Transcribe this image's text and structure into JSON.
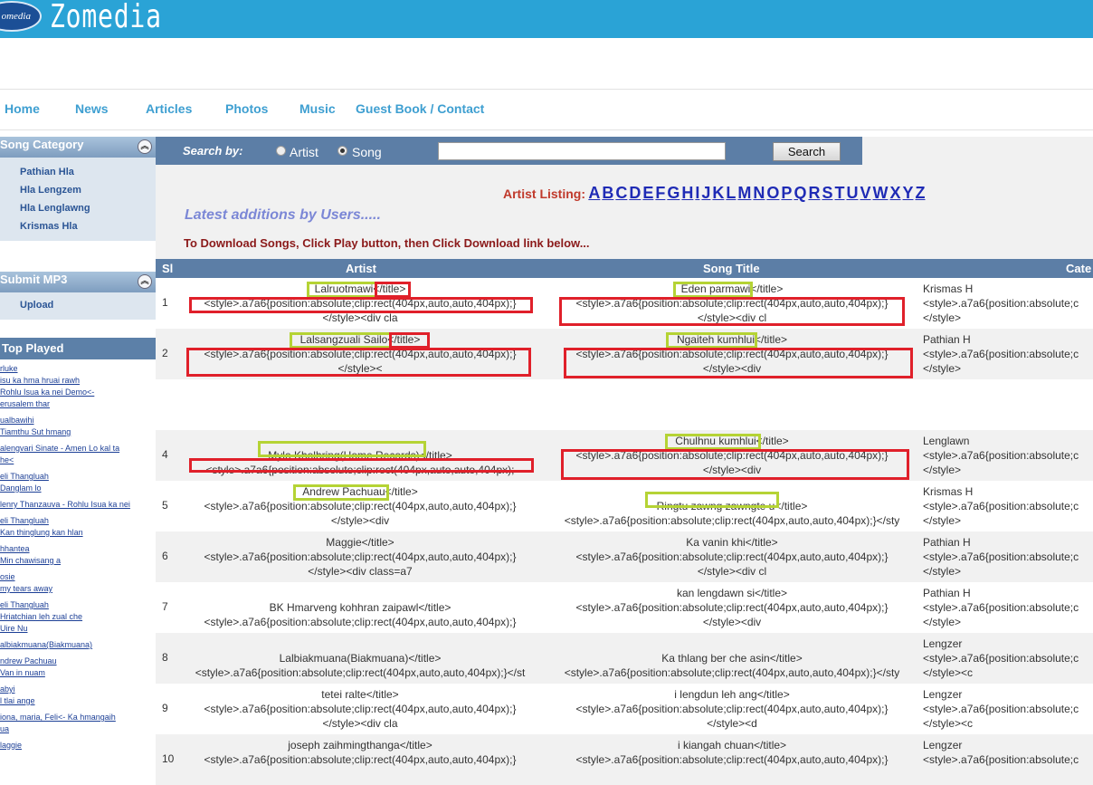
{
  "header": {
    "logo_badge": "omedia",
    "site_name": "Zomedia",
    "colors": {
      "bar": "#2aa3d6"
    }
  },
  "nav": [
    "Home",
    "News",
    "Articles",
    "Photos",
    "Music",
    "Guest Book / Contact"
  ],
  "sidebar": {
    "song_category": {
      "title": "Song Category",
      "items": [
        "Pathian Hla",
        "Hla Lengzem",
        "Hla Lenglawng",
        "Krismas Hla"
      ]
    },
    "submit": {
      "title": "Submit MP3",
      "items": [
        "Upload"
      ]
    },
    "top_played": {
      "title": "Top Played",
      "groups": [
        [
          "rluke",
          "isu ka hma hruai rawh",
          "Rohlu Isua ka nei Demo<-",
          "erusalem thar"
        ],
        [
          "ualbawihi",
          "Tiamthu Sut hmang"
        ],
        [
          "alengvari Sinate - Amen Lo kal ta",
          "he<"
        ],
        [
          "eli Thangluah",
          "Danglam lo"
        ],
        [
          "lenry Thanzauva - Rohlu Isua ka nei"
        ],
        [
          "eli Thangluah",
          "Kan thinglung kan hlan"
        ],
        [
          "hhantea",
          "Min chawisang a"
        ],
        [
          "osie",
          "my tears away"
        ],
        [
          "eli Thangluah",
          "Hriatchian leh zual che",
          "Uire Nu"
        ],
        [
          "albiakmuana(Biakmuana)"
        ],
        [
          "ndrew Pachuau",
          "Van in nuam"
        ],
        [
          "abyi",
          "l tlai ange"
        ],
        [
          "iona, maria, Feli<- Ka hmangaih",
          "ua"
        ],
        [
          "laggie"
        ]
      ]
    }
  },
  "search": {
    "label": "Search by:",
    "options": [
      "Artist",
      "Song"
    ],
    "selected": "Song",
    "value": "",
    "button": "Search"
  },
  "artist_listing": {
    "label": "Artist Listing:",
    "letters": [
      "A",
      "B",
      "C",
      "D",
      "E",
      "F",
      "G",
      "H",
      "I",
      "J",
      "K",
      "L",
      "M",
      "N",
      "O",
      "P",
      "Q",
      "R",
      "S",
      "T",
      "U",
      "V",
      "W",
      "X",
      "Y",
      "Z"
    ]
  },
  "latest_title": "Latest additions by Users.....",
  "download_note": "To Download Songs, Click Play button, then Click Download link below...",
  "table": {
    "headers": {
      "sl": "Sl",
      "artist": "Artist",
      "song": "Song Title",
      "category": "Cate"
    },
    "rows": [
      {
        "sl": "1",
        "artist": [
          "Lalruotmawi</title>",
          "<style>.a7a6{position:absolute;clip:rect(404px,auto,auto,404px);}",
          "</style><div cla"
        ],
        "song": [
          "Eden parmawi</title>",
          "<style>.a7a6{position:absolute;clip:rect(404px,auto,auto,404px);}",
          "</style><div cl"
        ],
        "category": [
          "Krismas H",
          "<style>.a7a6{position:absolute;c",
          "</style>"
        ]
      },
      {
        "sl": "2",
        "artist": [
          "Lalsangzuali Sailo</title>",
          "<style>.a7a6{position:absolute;clip:rect(404px,auto,auto,404px);}",
          "</style><"
        ],
        "song": [
          "Ngaiteh kumhlui</title>",
          "<style>.a7a6{position:absolute;clip:rect(404px,auto,auto,404px);}",
          "</style><div"
        ],
        "category": [
          "Pathian H",
          "<style>.a7a6{position:absolute;c",
          "</style>"
        ]
      },
      {
        "sl": "",
        "artist": [
          "",
          "",
          ""
        ],
        "song": [
          "",
          "",
          ""
        ],
        "category": [
          "",
          "",
          ""
        ]
      },
      {
        "sl": "4",
        "artist": [
          "",
          "Mylo Kholhring(Home Records)</title>",
          "<style>.a7a6{position:absolute;clip:rect(404px,auto,auto,404px);"
        ],
        "song": [
          "Chulhnu kumhlui</title>",
          "<style>.a7a6{position:absolute;clip:rect(404px,auto,auto,404px);}",
          "</style><div"
        ],
        "category": [
          "Lenglawn",
          "<style>.a7a6{position:absolute;c",
          "</style>"
        ]
      },
      {
        "sl": "5",
        "artist": [
          "Andrew Pachuau</title>",
          "<style>.a7a6{position:absolute;clip:rect(404px,auto,auto,404px);}",
          "</style><div"
        ],
        "song": [
          "",
          "Ringtu zawng zawngte u</title>",
          "<style>.a7a6{position:absolute;clip:rect(404px,auto,auto,404px);}</sty"
        ],
        "category": [
          "Krismas H",
          "<style>.a7a6{position:absolute;c",
          "</style>"
        ]
      },
      {
        "sl": "6",
        "artist": [
          "Maggie</title>",
          "<style>.a7a6{position:absolute;clip:rect(404px,auto,auto,404px);}",
          "</style><div class=a7"
        ],
        "song": [
          "Ka vanin khi</title>",
          "<style>.a7a6{position:absolute;clip:rect(404px,auto,auto,404px);}",
          "</style><div cl"
        ],
        "category": [
          "Pathian H",
          "<style>.a7a6{position:absolute;c",
          "</style>"
        ]
      },
      {
        "sl": "7",
        "artist": [
          "",
          "BK Hmarveng kohhran zaipawl</title>",
          "<style>.a7a6{position:absolute;clip:rect(404px,auto,auto,404px);}"
        ],
        "song": [
          "kan lengdawn si</title>",
          "<style>.a7a6{position:absolute;clip:rect(404px,auto,auto,404px);}",
          "</style><div"
        ],
        "category": [
          "Pathian H",
          "<style>.a7a6{position:absolute;c",
          "</style>"
        ]
      },
      {
        "sl": "8",
        "artist": [
          "",
          "Lalbiakmuana(Biakmuana)</title>",
          "<style>.a7a6{position:absolute;clip:rect(404px,auto,auto,404px);}</st"
        ],
        "song": [
          "",
          "Ka thlang ber che asin</title>",
          "<style>.a7a6{position:absolute;clip:rect(404px,auto,auto,404px);}</sty"
        ],
        "category": [
          "Lengzer",
          "<style>.a7a6{position:absolute;c",
          "</style><c"
        ]
      },
      {
        "sl": "9",
        "artist": [
          "tetei ralte</title>",
          "<style>.a7a6{position:absolute;clip:rect(404px,auto,auto,404px);}",
          "</style><div cla"
        ],
        "song": [
          "i lengdun leh ang</title>",
          "<style>.a7a6{position:absolute;clip:rect(404px,auto,auto,404px);}",
          "</style><d"
        ],
        "category": [
          "Lengzer",
          "<style>.a7a6{position:absolute;c",
          "</style><c"
        ]
      },
      {
        "sl": "10",
        "artist": [
          "joseph zaihmingthanga</title>",
          "<style>.a7a6{position:absolute;clip:rect(404px,auto,auto,404px);}",
          ""
        ],
        "song": [
          "i kiangah chuan</title>",
          "<style>.a7a6{position:absolute;clip:rect(404px,auto,auto,404px);}",
          ""
        ],
        "category": [
          "Lengzer",
          "<style>.a7a6{position:absolute;c",
          ""
        ]
      }
    ]
  }
}
